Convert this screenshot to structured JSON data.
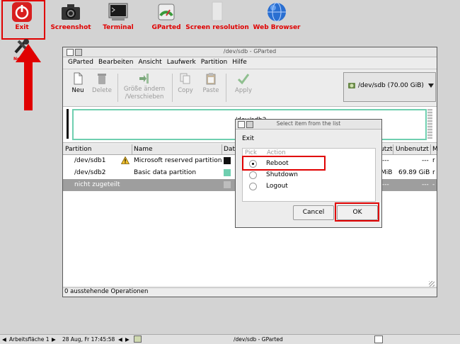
{
  "desktop": {
    "icons": [
      {
        "label": "Exit"
      },
      {
        "label": "Screenshot"
      },
      {
        "label": "Terminal"
      },
      {
        "label": "GParted"
      },
      {
        "label": "Screen resolution"
      },
      {
        "label": "Web Browser"
      },
      {
        "label": "Netw..."
      }
    ],
    "accent_color": "#e00000"
  },
  "gparted": {
    "title": "/dev/sdb - GParted",
    "menu": [
      "GParted",
      "Bearbeiten",
      "Ansicht",
      "Laufwerk",
      "Partition",
      "Hilfe"
    ],
    "toolbar": {
      "new": "Neu",
      "delete": "Delete",
      "resize_1": "Größe ändern",
      "resize_2": "/Verschieben",
      "copy": "Copy",
      "paste": "Paste",
      "apply": "Apply"
    },
    "device": "/dev/sdb  (70.00 GiB)",
    "graph_label": "/dev/sdb2",
    "columns": {
      "partition": "Partition",
      "name": "Name",
      "dat": "Date",
      "used": "utzt",
      "unused": "Unbenutzt",
      "flags": "M"
    },
    "rows": [
      {
        "partition": "/dev/sdb1",
        "name": "Microsoft reserved partition",
        "used": "---",
        "unused": "---",
        "flags": "r"
      },
      {
        "partition": "/dev/sdb2",
        "name": "Basic data partition",
        "used": "MiB",
        "unused": "69.89 GiB",
        "flags": "r"
      },
      {
        "partition": "nicht zugeteilt",
        "name": "",
        "used": "---",
        "unused": "---",
        "flags": "-"
      }
    ],
    "status": "0 ausstehende Operationen"
  },
  "dialog": {
    "title": "Select item from the list",
    "prompt": "Exit",
    "header_pick": "Pick",
    "header_action": "Action",
    "options": [
      {
        "label": "Reboot",
        "selected": true
      },
      {
        "label": "Shutdown",
        "selected": false
      },
      {
        "label": "Logout",
        "selected": false
      }
    ],
    "cancel": "Cancel",
    "ok": "OK"
  },
  "taskbar": {
    "workspace": "Arbeitsfläche 1",
    "datetime": "28 Aug, Fr 17:45:58",
    "task": "/dev/sdb - GParted"
  }
}
